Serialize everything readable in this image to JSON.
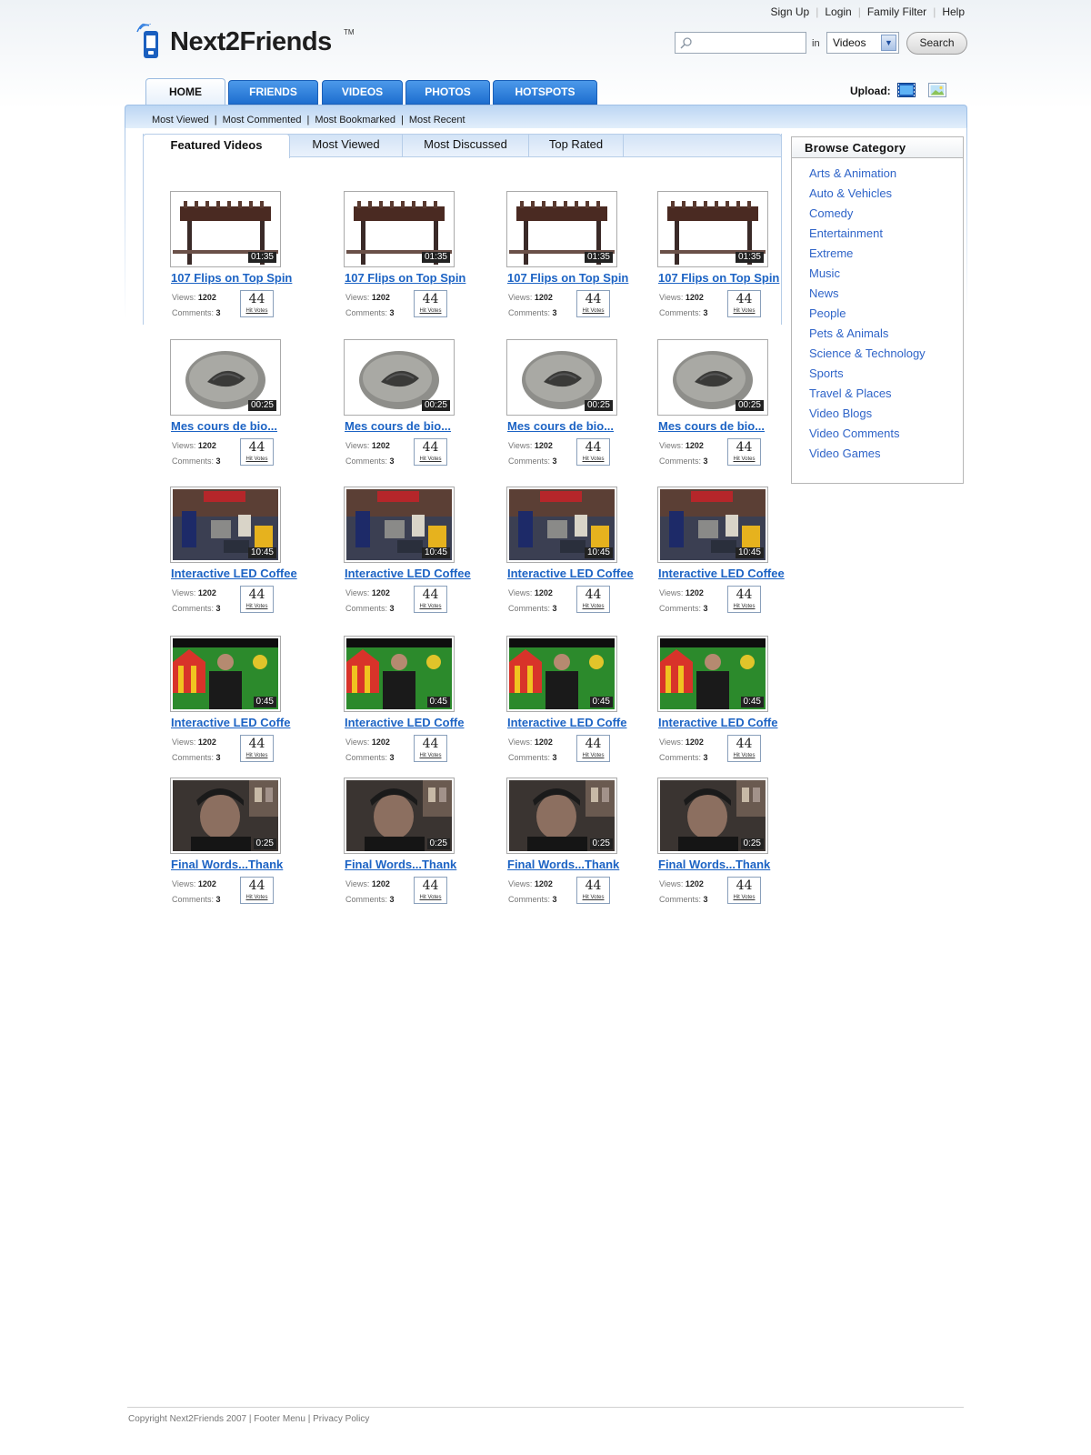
{
  "header": {
    "top_links": [
      "Sign Up",
      "Login",
      "Family Filter",
      "Help"
    ],
    "logo": {
      "text": "Next2Friends",
      "tm": "TM"
    },
    "search": {
      "placeholder": "",
      "in_label": "in",
      "scope": "Videos",
      "button": "Search"
    }
  },
  "nav": {
    "tabs": [
      "HOME",
      "FRIENDS",
      "VIDEOS",
      "PHOTOS",
      "HOTSPOTS"
    ],
    "active": "HOME",
    "upload_label": "Upload:",
    "upload_icons": [
      "video-upload-icon",
      "photo-upload-icon"
    ]
  },
  "subnav": [
    "Most Viewed",
    "Most Commented",
    "Most Bookmarked",
    "Most Recent"
  ],
  "feature_tabs": [
    "Featured Videos",
    "Most Viewed",
    "Most Discussed",
    "Top Rated"
  ],
  "videos": [
    {
      "title": "107 Flips on Top Spin",
      "duration": "01:35",
      "views_label": "Views:",
      "views": "1202",
      "comments_label": "Comments:",
      "comments": "3",
      "votes": "44",
      "votes_label": "Hit Votes",
      "art": "sky"
    },
    {
      "title": "107 Flips on Top Spin",
      "duration": "01:35",
      "views_label": "Views:",
      "views": "1202",
      "comments_label": "Comments:",
      "comments": "3",
      "votes": "44",
      "votes_label": "Hit Votes",
      "art": "sky"
    },
    {
      "title": "107 Flips on Top Spin",
      "duration": "01:35",
      "views_label": "Views:",
      "views": "1202",
      "comments_label": "Comments:",
      "comments": "3",
      "votes": "44",
      "votes_label": "Hit Votes",
      "art": "sky"
    },
    {
      "title": "107 Flips on Top Spin",
      "duration": "01:35",
      "views_label": "Views:",
      "views": "1202",
      "comments_label": "Comments:",
      "comments": "3",
      "votes": "44",
      "votes_label": "Hit Votes",
      "art": "sky"
    },
    {
      "title": "Mes cours de bio...",
      "duration": "00:25",
      "views_label": "Views:",
      "views": "1202",
      "comments_label": "Comments:",
      "comments": "3",
      "votes": "44",
      "votes_label": "Hit Votes",
      "art": "rock"
    },
    {
      "title": "Mes cours de bio...",
      "duration": "00:25",
      "views_label": "Views:",
      "views": "1202",
      "comments_label": "Comments:",
      "comments": "3",
      "votes": "44",
      "votes_label": "Hit Votes",
      "art": "rock"
    },
    {
      "title": "Mes cours de bio...",
      "duration": "00:25",
      "views_label": "Views:",
      "views": "1202",
      "comments_label": "Comments:",
      "comments": "3",
      "votes": "44",
      "votes_label": "Hit Votes",
      "art": "rock"
    },
    {
      "title": "Mes cours de bio...",
      "duration": "00:25",
      "views_label": "Views:",
      "views": "1202",
      "comments_label": "Comments:",
      "comments": "3",
      "votes": "44",
      "votes_label": "Hit Votes",
      "art": "rock"
    },
    {
      "title": "Interactive LED Coffee",
      "duration": "10:45",
      "views_label": "Views:",
      "views": "1202",
      "comments_label": "Comments:",
      "comments": "3",
      "votes": "44",
      "votes_label": "Hit Votes",
      "art": "room"
    },
    {
      "title": "Interactive LED Coffee",
      "duration": "10:45",
      "views_label": "Views:",
      "views": "1202",
      "comments_label": "Comments:",
      "comments": "3",
      "votes": "44",
      "votes_label": "Hit Votes",
      "art": "room"
    },
    {
      "title": "Interactive LED Coffee",
      "duration": "10:45",
      "views_label": "Views:",
      "views": "1202",
      "comments_label": "Comments:",
      "comments": "3",
      "votes": "44",
      "votes_label": "Hit Votes",
      "art": "room"
    },
    {
      "title": "Interactive LED Coffee",
      "duration": "10:45",
      "views_label": "Views:",
      "views": "1202",
      "comments_label": "Comments:",
      "comments": "3",
      "votes": "44",
      "votes_label": "Hit Votes",
      "art": "room"
    },
    {
      "title": "Interactive LED Coffe",
      "duration": "0:45",
      "views_label": "Views:",
      "views": "1202",
      "comments_label": "Comments:",
      "comments": "3",
      "votes": "44",
      "votes_label": "Hit Votes",
      "art": "green"
    },
    {
      "title": "Interactive LED Coffe",
      "duration": "0:45",
      "views_label": "Views:",
      "views": "1202",
      "comments_label": "Comments:",
      "comments": "3",
      "votes": "44",
      "votes_label": "Hit Votes",
      "art": "green"
    },
    {
      "title": "Interactive LED Coffe",
      "duration": "0:45",
      "views_label": "Views:",
      "views": "1202",
      "comments_label": "Comments:",
      "comments": "3",
      "votes": "44",
      "votes_label": "Hit Votes",
      "art": "green"
    },
    {
      "title": "Interactive LED Coffe",
      "duration": "0:45",
      "views_label": "Views:",
      "views": "1202",
      "comments_label": "Comments:",
      "comments": "3",
      "votes": "44",
      "votes_label": "Hit Votes",
      "art": "green"
    },
    {
      "title": "Final Words...Thank",
      "duration": "0:25",
      "views_label": "Views:",
      "views": "1202",
      "comments_label": "Comments:",
      "comments": "3",
      "votes": "44",
      "votes_label": "Hit Votes",
      "art": "dark"
    },
    {
      "title": "Final Words...Thank",
      "duration": "0:25",
      "views_label": "Views:",
      "views": "1202",
      "comments_label": "Comments:",
      "comments": "3",
      "votes": "44",
      "votes_label": "Hit Votes",
      "art": "dark"
    },
    {
      "title": "Final Words...Thank",
      "duration": "0:25",
      "views_label": "Views:",
      "views": "1202",
      "comments_label": "Comments:",
      "comments": "3",
      "votes": "44",
      "votes_label": "Hit Votes",
      "art": "dark"
    },
    {
      "title": "Final Words...Thank",
      "duration": "0:25",
      "views_label": "Views:",
      "views": "1202",
      "comments_label": "Comments:",
      "comments": "3",
      "votes": "44",
      "votes_label": "Hit Votes",
      "art": "dark"
    }
  ],
  "categories": {
    "title": "Browse Category",
    "items": [
      "Arts & Animation",
      "Auto & Vehicles",
      "Comedy",
      "Entertainment",
      "Extreme",
      "Music",
      "News",
      "People",
      "Pets & Animals",
      "Science & Technology",
      "Sports",
      "Travel & Places",
      "Video Blogs",
      "Video Comments",
      "Video Games"
    ]
  },
  "footer": {
    "copyright": "Copyright Next2Friends 2007",
    "links": [
      "Footer Menu",
      "Privacy Policy"
    ]
  },
  "colors": {
    "link": "#1c63c4",
    "tab_blue": "#1d6ecf",
    "category_link": "#2f64c8"
  }
}
